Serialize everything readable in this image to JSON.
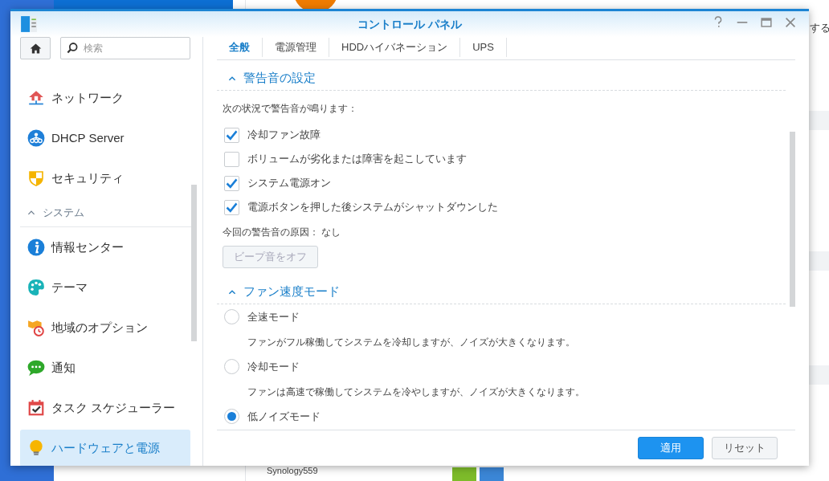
{
  "background_app": {
    "side_text": "する",
    "device_name": "Synology559"
  },
  "window": {
    "title": "コントロール パネル"
  },
  "search": {
    "placeholder": "検索"
  },
  "sidebar": {
    "items": [
      {
        "kind": "item",
        "label": "ネットワーク",
        "selected": false
      },
      {
        "kind": "item",
        "label": "DHCP Server",
        "selected": false
      },
      {
        "kind": "item",
        "label": "セキュリティ",
        "selected": false
      },
      {
        "kind": "header",
        "label": "システム",
        "expanded": true
      },
      {
        "kind": "item",
        "label": "情報センター",
        "selected": false
      },
      {
        "kind": "item",
        "label": "テーマ",
        "selected": false
      },
      {
        "kind": "item",
        "label": "地域のオプション",
        "selected": false
      },
      {
        "kind": "item",
        "label": "通知",
        "selected": false
      },
      {
        "kind": "item",
        "label": "タスク スケジューラー",
        "selected": false
      },
      {
        "kind": "item",
        "label": "ハードウェアと電源",
        "selected": true
      }
    ]
  },
  "tabs": [
    {
      "label": "全般",
      "selected": true
    },
    {
      "label": "電源管理",
      "selected": false
    },
    {
      "label": "HDDハイバネーション",
      "selected": false
    },
    {
      "label": "UPS",
      "selected": false
    }
  ],
  "beep_section": {
    "title": "警告音の設定",
    "expanded": true,
    "intro": "次の状況で警告音が鳴ります：",
    "options": [
      {
        "label": "冷却ファン故障",
        "checked": true
      },
      {
        "label": "ボリュームが劣化または障害を起こしています",
        "checked": false
      },
      {
        "label": "システム電源オン",
        "checked": true
      },
      {
        "label": "電源ボタンを押した後システムがシャットダウンした",
        "checked": true
      }
    ],
    "cause": "今回の警告音の原因： なし",
    "button": {
      "label": "ビープ音をオフ",
      "disabled": true
    }
  },
  "fan_section": {
    "title": "ファン速度モード",
    "expanded": true,
    "modes": [
      {
        "label": "全速モード",
        "description": "ファンがフル稼働してシステムを冷却しますが、ノイズが大きくなります。",
        "selected": false
      },
      {
        "label": "冷却モード",
        "description": "ファンは高速で稼働してシステムを冷やしますが、ノイズが大きくなります。",
        "selected": false
      },
      {
        "label": "低ノイズモード",
        "selected": true
      }
    ]
  },
  "buttons": [
    {
      "kind": "primary",
      "label": "適用"
    },
    {
      "kind": "secondary",
      "label": "リセット"
    }
  ]
}
